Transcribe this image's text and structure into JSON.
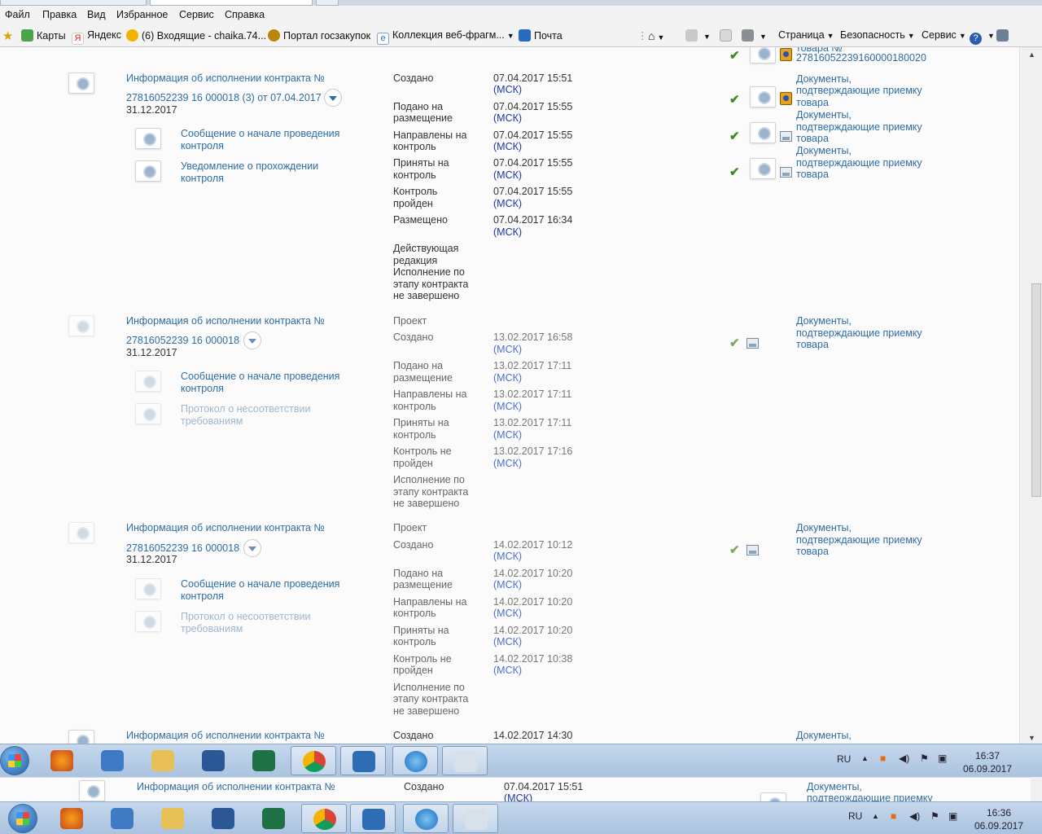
{
  "menubar": {
    "items": [
      "Файл",
      "Правка",
      "Вид",
      "Избранное",
      "Сервис",
      "Справка"
    ]
  },
  "favorites": {
    "items": [
      "Карты",
      "Яндекс",
      "(6) Входящие - chaika.74...",
      "Портал госзакупок",
      "Коллекция веб-фрагм...",
      "Почта"
    ],
    "right": [
      "Страница",
      "Безопасность",
      "Сервис"
    ]
  },
  "top_partial": {
    "doc_text_1": "товара №",
    "doc_text_2": "278160522391600001800 20"
  },
  "records": [
    {
      "title_line1": "Информация об исполнении контракта №",
      "title_line2": "27816052239 16 000018 (3) от 07.04.2017",
      "date": "31.12.2017",
      "sub": [
        {
          "text": "Сообщение о начале проведения контроля",
          "l1": "Сообщение о начале проведения",
          "l2": "контроля"
        },
        {
          "text": "Уведомление о прохождении контроля",
          "l1": "Уведомление о прохождении",
          "l2": "контроля"
        }
      ],
      "statuses": [
        {
          "l1": "Создано",
          "l2": "",
          "date": "07.04.2017 15:51",
          "tz": "(МСК)"
        },
        {
          "l1": "Подано на",
          "l2": "размещение",
          "date": "07.04.2017 15:55",
          "tz": "(МСК)"
        },
        {
          "l1": "Направлены на",
          "l2": "контроль",
          "date": "07.04.2017 15:55",
          "tz": "(МСК)"
        },
        {
          "l1": "Приняты на",
          "l2": "контроль",
          "date": "07.04.2017 15:55",
          "tz": "(МСК)"
        },
        {
          "l1": "Контроль",
          "l2": "пройден",
          "date": "07.04.2017 15:55",
          "tz": "(МСК)"
        },
        {
          "l1": "Размещено",
          "l2": "",
          "date": "07.04.2017 16:34",
          "tz": "(МСК)"
        }
      ],
      "note": [
        "Действующая",
        "редакция",
        "Исполнение по",
        "этапу контракта",
        "не завершено"
      ],
      "docs": [
        [
          "Документы,",
          "подтверждающие приемку",
          "товара"
        ],
        [
          "Документы,",
          "подтверждающие приемку",
          "товара"
        ],
        [
          "Документы,",
          "подтверждающие приемку",
          "товара"
        ]
      ]
    },
    {
      "title_line1": "Информация об исполнении контракта №",
      "title_line2": "27816052239 16 000018",
      "date": "31.12.2017",
      "sub": [
        {
          "l1": "Сообщение о начале проведения",
          "l2": "контроля"
        },
        {
          "l1": "Протокол о несоответствии",
          "l2": "требованиям"
        }
      ],
      "head": "Проект",
      "statuses": [
        {
          "l1": "Создано",
          "l2": "",
          "date": "13.02.2017 16:58",
          "tz": "(МСК)"
        },
        {
          "l1": "Подано на",
          "l2": "размещение",
          "date": "13.02.2017 17:11",
          "tz": "(МСК)"
        },
        {
          "l1": "Направлены на",
          "l2": "контроль",
          "date": "13.02.2017 17:11",
          "tz": "(МСК)"
        },
        {
          "l1": "Приняты на",
          "l2": "контроль",
          "date": "13.02.2017 17:11",
          "tz": "(МСК)"
        },
        {
          "l1": "Контроль не",
          "l2": "пройден",
          "date": "13.02.2017 17:16",
          "tz": "(МСК)"
        }
      ],
      "note": [
        "Исполнение по",
        "этапу контракта",
        "не завершено"
      ],
      "docs": [
        [
          "Документы,",
          "подтверждающие приемку",
          "товара"
        ]
      ]
    },
    {
      "title_line1": "Информация об исполнении контракта №",
      "title_line2": "27816052239 16 000018",
      "date": "31.12.2017",
      "sub": [
        {
          "l1": "Сообщение о начале проведения",
          "l2": "контроля"
        },
        {
          "l1": "Протокол о несоответствии",
          "l2": "требованиям"
        }
      ],
      "head": "Проект",
      "statuses": [
        {
          "l1": "Создано",
          "l2": "",
          "date": "14.02.2017 10:12",
          "tz": "(МСК)"
        },
        {
          "l1": "Подано на",
          "l2": "размещение",
          "date": "14.02.2017 10:20",
          "tz": "(МСК)"
        },
        {
          "l1": "Направлены на",
          "l2": "контроль",
          "date": "14.02.2017 10:20",
          "tz": "(МСК)"
        },
        {
          "l1": "Приняты на",
          "l2": "контроль",
          "date": "14.02.2017 10:20",
          "tz": "(МСК)"
        },
        {
          "l1": "Контроль не",
          "l2": "пройден",
          "date": "14.02.2017 10:38",
          "tz": "(МСК)"
        }
      ],
      "note": [
        "Исполнение по",
        "этапу контракта",
        "не завершено"
      ],
      "docs": [
        [
          "Документы,",
          "подтверждающие приемку",
          "товара"
        ]
      ]
    },
    {
      "title_line1": "Информация об исполнении контракта №",
      "status": "Создано",
      "date": "14.02.2017 14:30",
      "doc": "Документы,"
    }
  ],
  "ghost": {
    "title": "Информация об исполнении контракта №",
    "status": "Создано",
    "date": "07.04.2017 15:51",
    "tz": "(МСК)",
    "doc1": "Документы,",
    "doc2": "подтверждающие приемку"
  },
  "taskbar": {
    "lang": "RU",
    "time": "16:37",
    "date": "06.09.2017"
  },
  "taskbar2": {
    "lang": "RU",
    "time": "16:36",
    "date": "06.09.2017"
  },
  "colors": {
    "link": "#2e6da4",
    "link_faded": "#9db7cf",
    "tz": "#1a36a8",
    "check": "#3d8b1f"
  }
}
